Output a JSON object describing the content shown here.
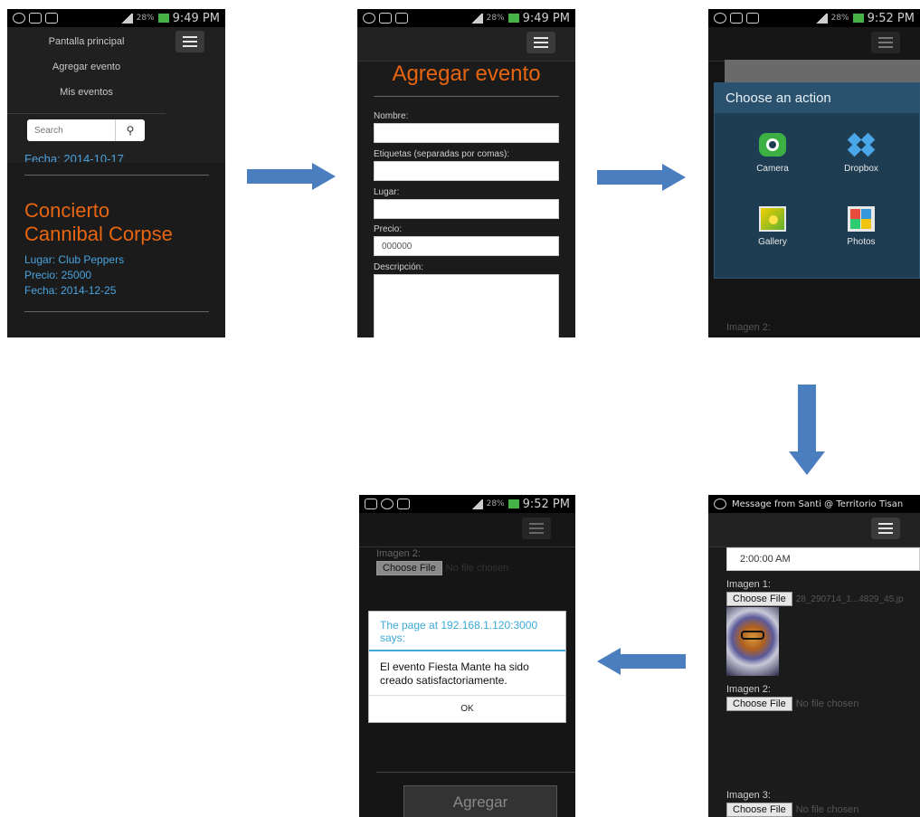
{
  "status": {
    "time1": "9:49 PM",
    "time2": "9:49 PM",
    "time3": "9:52 PM",
    "time4": "9:52 PM",
    "battery": "28%"
  },
  "screen1": {
    "menu": [
      "Pantalla principal",
      "Agregar evento",
      "Mis eventos"
    ],
    "search_placeholder": "Search",
    "prev_date": "Fecha: 2014-10-17",
    "event_title_line1": "Concierto",
    "event_title_line2": "Cannibal Corpse",
    "place": "Lugar: Club Peppers",
    "price": "Precio: 25000",
    "date": "Fecha: 2014-12-25"
  },
  "screen2": {
    "title": "Agregar evento",
    "label_name": "Nombre:",
    "label_tags": "Etiquetas (separadas por comas):",
    "label_place": "Lugar:",
    "label_price": "Precio:",
    "price_value": "000000",
    "label_desc": "Descripción:"
  },
  "screen3": {
    "dialog_title": "Choose an action",
    "apps": [
      "Camera",
      "Dropbox",
      "Gallery",
      "Photos"
    ],
    "bottom_label": "Imagen 2:"
  },
  "screen4": {
    "notification": "Message from Santi @ Territorio Tisan",
    "time_value": "2:00:00 AM",
    "img1_label": "Imagen 1:",
    "choose_label": "Choose File",
    "img1_file": "28_290714_1...4829_45.jp",
    "img2_label": "Imagen 2:",
    "no_file": "No file chosen",
    "img3_label": "Imagen 3:"
  },
  "screen5": {
    "img2_label": "Imagen 2:",
    "choose_label": "Choose File",
    "no_file": "No file chosen",
    "alert_title": "The page at 192.168.1.120:3000 says:",
    "alert_message": "El evento Fiesta Mante ha sido creado satisfactoriamente.",
    "ok": "OK",
    "submit": "Agregar"
  }
}
